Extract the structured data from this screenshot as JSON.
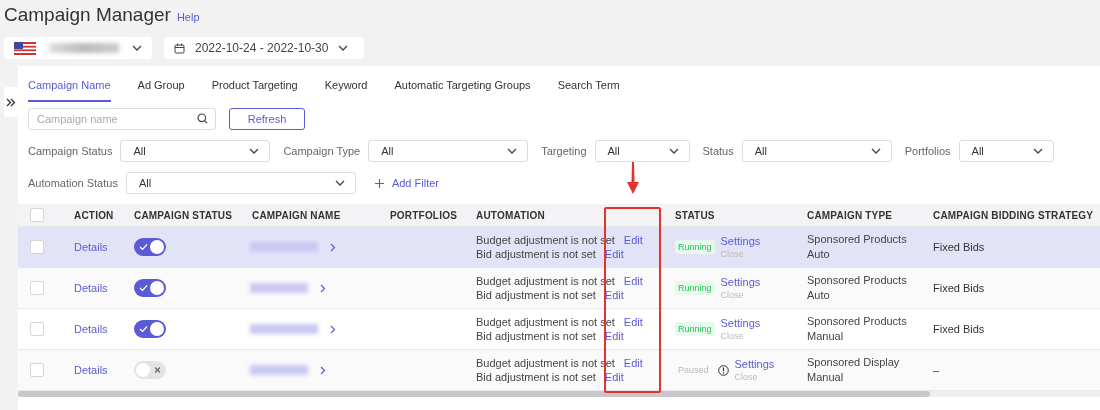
{
  "header": {
    "title": "Campaign Manager",
    "help": "Help"
  },
  "date_range": "2022-10-24 - 2022-10-30",
  "tabs": [
    {
      "label": "Campaign Name",
      "selected": true
    },
    {
      "label": "Ad Group",
      "selected": false
    },
    {
      "label": "Product Targeting",
      "selected": false
    },
    {
      "label": "Keyword",
      "selected": false
    },
    {
      "label": "Automatic Targeting Groups",
      "selected": false
    },
    {
      "label": "Search Term",
      "selected": false
    }
  ],
  "search": {
    "placeholder": "Campaign name"
  },
  "refresh_button": "Refresh",
  "filters": [
    {
      "label": "Campaign Status",
      "value": "All"
    },
    {
      "label": "Campaign Type",
      "value": "All"
    },
    {
      "label": "Targeting",
      "value": "All"
    },
    {
      "label": "Status",
      "value": "All"
    },
    {
      "label": "Portfolios",
      "value": "All"
    },
    {
      "label": "Automation Status",
      "value": "All"
    }
  ],
  "add_filter": "Add Filter",
  "table": {
    "select_all": {
      "checked": false
    },
    "columns": [
      "ACTION",
      "CAMPAIGN STATUS",
      "CAMPAIGN NAME",
      "PORTFOLIOS",
      "AUTOMATION",
      "STATUS",
      "CAMPAIGN TYPE",
      "CAMPAIGN BIDDING STRATEGY"
    ],
    "rows": [
      {
        "checked": false,
        "highlighted": true,
        "action": "Details",
        "enabled": true,
        "automation": [
          {
            "text": "Budget adjustment is not set",
            "link": "Edit"
          },
          {
            "text": "Bid adjustment is not set",
            "link": "Edit"
          }
        ],
        "status": {
          "kind": "running",
          "label": "Running"
        },
        "settings": "Settings",
        "close": "Close",
        "campaign_type": "Sponsored Products Auto",
        "bidding": "Fixed Bids"
      },
      {
        "checked": false,
        "highlighted": false,
        "action": "Details",
        "enabled": true,
        "automation": [
          {
            "text": "Budget adjustment is not set",
            "link": "Edit"
          },
          {
            "text": "Bid adjustment is not set",
            "link": "Edit"
          }
        ],
        "status": {
          "kind": "running",
          "label": "Running"
        },
        "settings": "Settings",
        "close": "Close",
        "campaign_type": "Sponsored Products Auto",
        "bidding": "Fixed Bids"
      },
      {
        "checked": false,
        "highlighted": false,
        "action": "Details",
        "enabled": true,
        "automation": [
          {
            "text": "Budget adjustment is not set",
            "link": "Edit"
          },
          {
            "text": "Bid adjustment is not set",
            "link": "Edit"
          }
        ],
        "status": {
          "kind": "running",
          "label": "Running"
        },
        "settings": "Settings",
        "close": "Close",
        "campaign_type": "Sponsored Products Manual",
        "bidding": "Fixed Bids"
      },
      {
        "checked": false,
        "highlighted": false,
        "action": "Details",
        "enabled": false,
        "automation": [
          {
            "text": "Budget adjustment is not set",
            "link": "Edit"
          },
          {
            "text": "Bid adjustment is not set",
            "link": "Edit"
          }
        ],
        "status": {
          "kind": "paused",
          "label": "Paused"
        },
        "settings": "Settings",
        "close": "Close",
        "campaign_type": "Sponsored Display Manual",
        "bidding": "–"
      }
    ]
  }
}
